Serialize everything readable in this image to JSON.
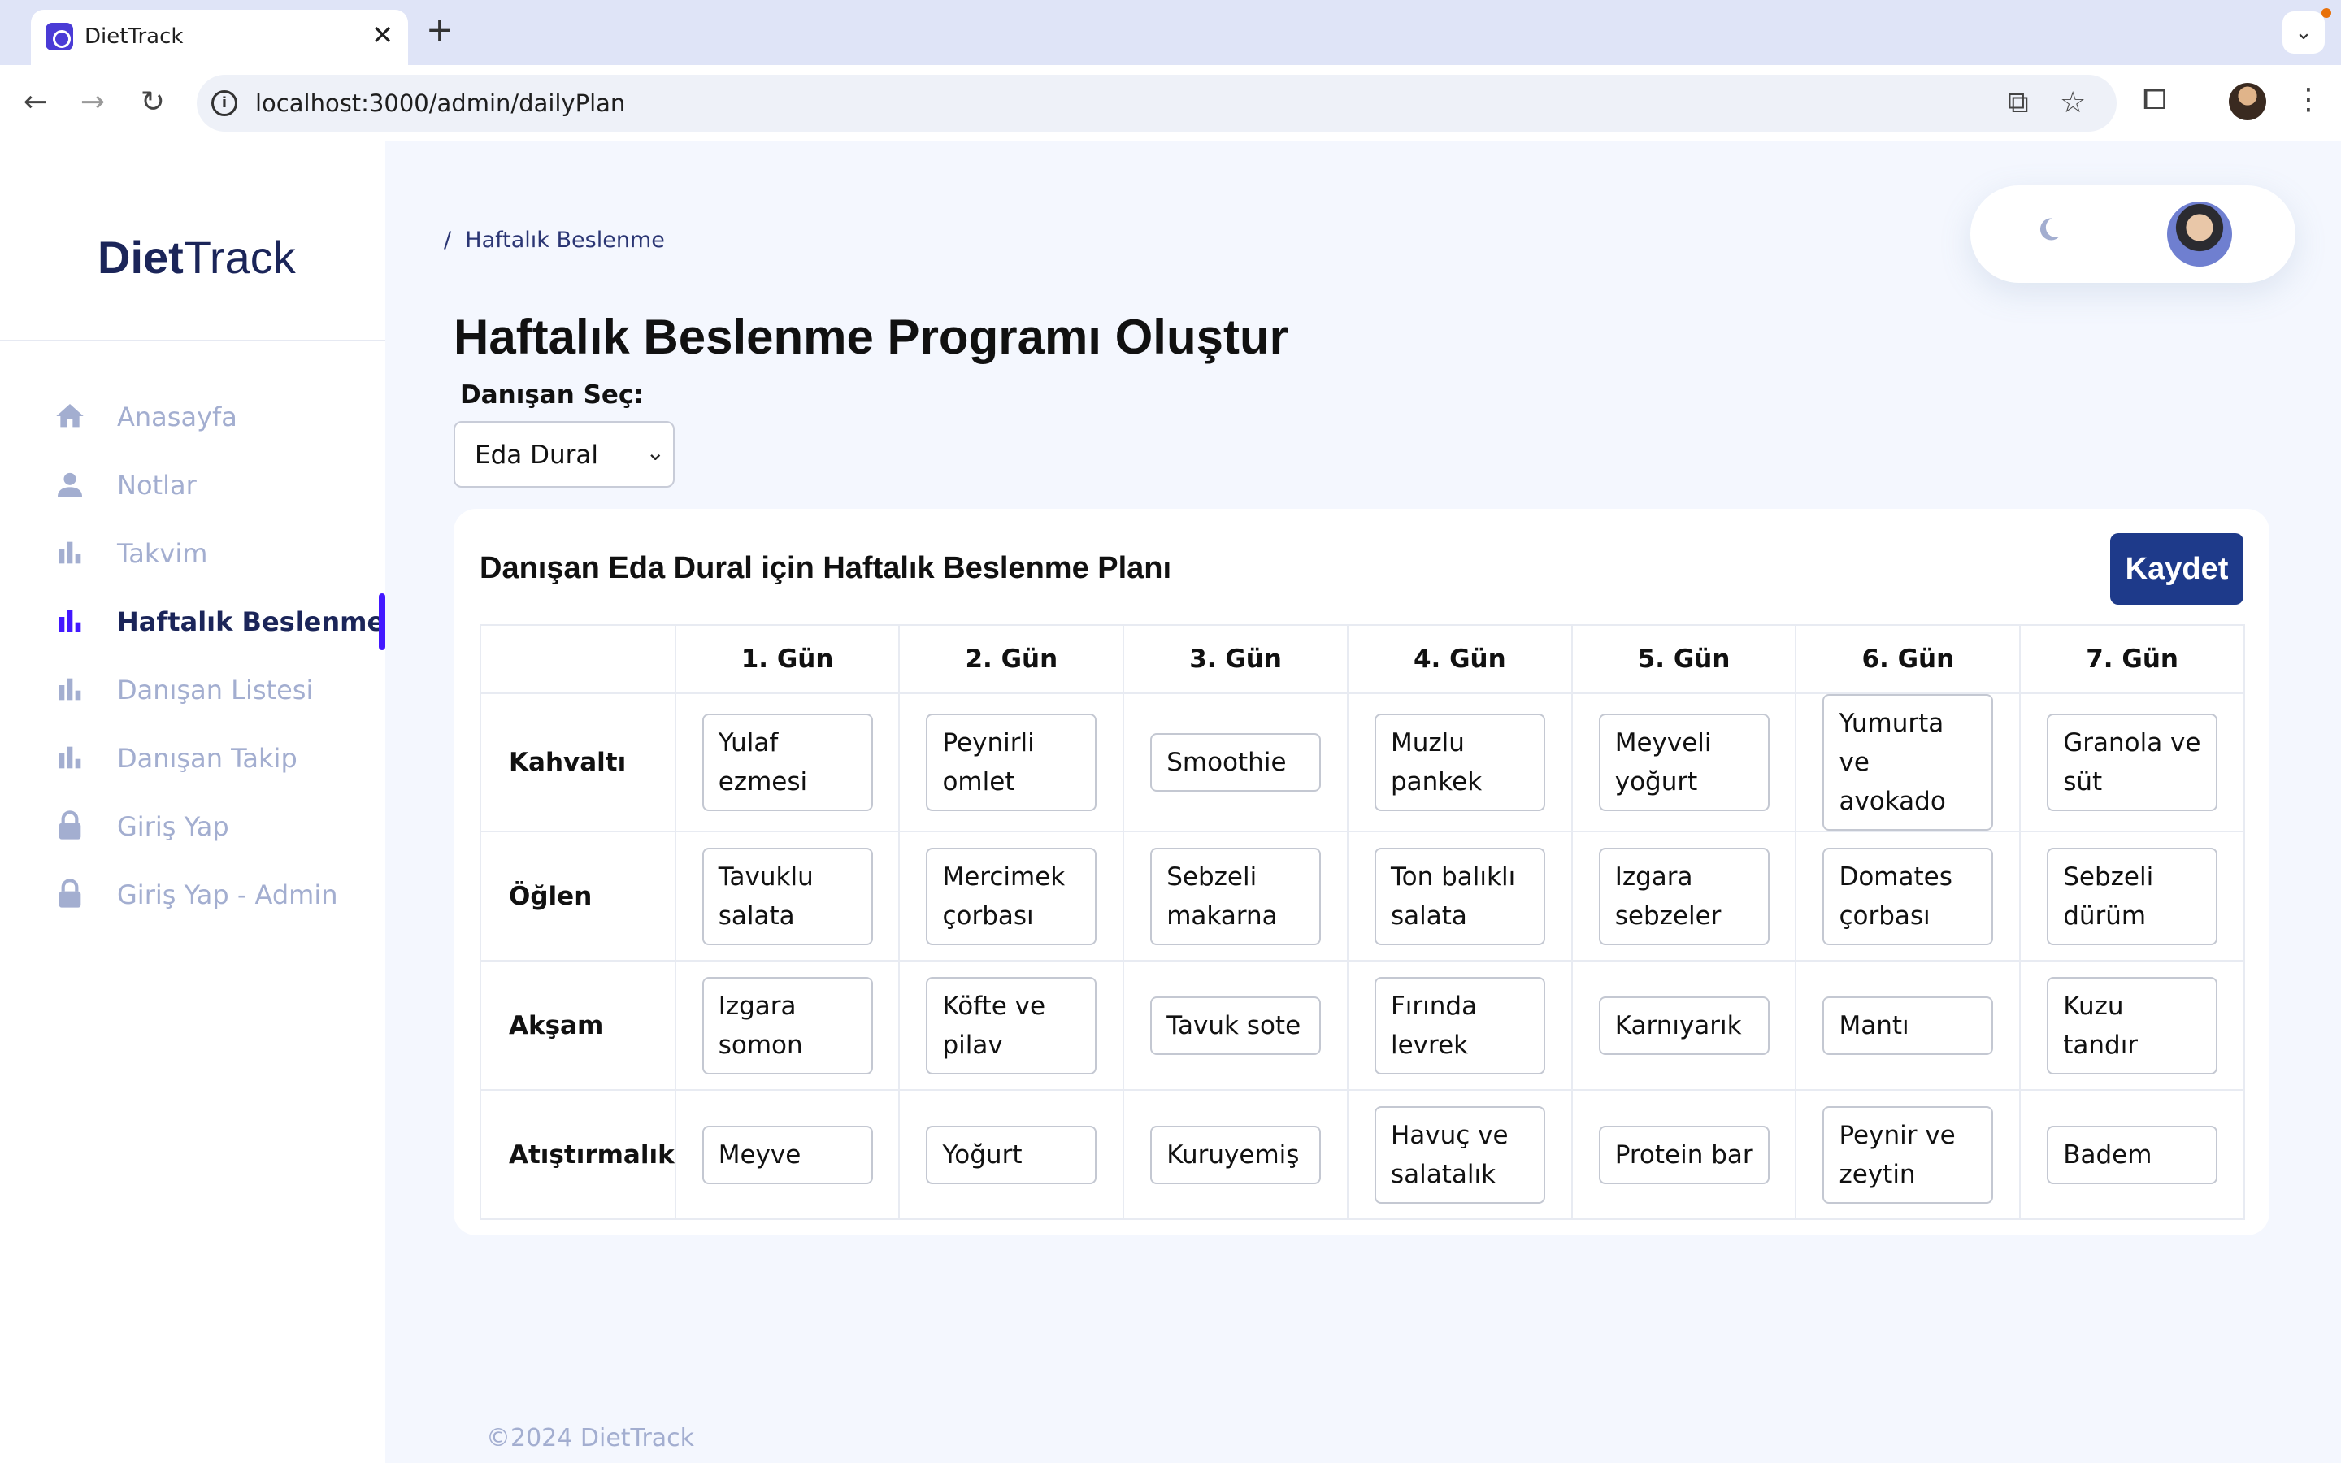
{
  "browser": {
    "tab_title": "DietTrack",
    "tab_close": "✕",
    "new_tab": "+",
    "url": "localhost:3000/admin/dailyPlan"
  },
  "sidebar": {
    "logo_bold": "Diet",
    "logo_light": "Track",
    "items": [
      {
        "label": "Anasayfa",
        "icon": "home-icon"
      },
      {
        "label": "Notlar",
        "icon": "person-icon"
      },
      {
        "label": "Takvim",
        "icon": "bar-chart-icon"
      },
      {
        "label": "Haftalık Beslenme",
        "icon": "bar-chart-icon",
        "active": true
      },
      {
        "label": "Danışan Listesi",
        "icon": "bar-chart-icon"
      },
      {
        "label": "Danışan Takip",
        "icon": "bar-chart-icon"
      },
      {
        "label": "Giriş Yap",
        "icon": "lock-icon"
      },
      {
        "label": "Giriş Yap - Admin",
        "icon": "lock-icon"
      }
    ]
  },
  "header": {
    "breadcrumb_sep": "/",
    "breadcrumb": "Haftalık Beslenme",
    "title": "Haftalık Beslenme Programı Oluştur"
  },
  "client": {
    "label": "Danışan Seç:",
    "selected": "Eda Dural"
  },
  "plan": {
    "title": "Danışan Eda Dural için Haftalık Beslenme Planı",
    "save_label": "Kaydet",
    "days": [
      "1. Gün",
      "2. Gün",
      "3. Gün",
      "4. Gün",
      "5. Gün",
      "6. Gün",
      "7. Gün"
    ],
    "meals": [
      {
        "name": "Kahvaltı",
        "items": [
          "Yulaf ezmesi",
          "Peynirli omlet",
          "Smoothie",
          "Muzlu pankek",
          "Meyveli yoğurt",
          "Yumurta ve avokado",
          "Granola ve süt"
        ]
      },
      {
        "name": "Öğlen",
        "items": [
          "Tavuklu salata",
          "Mercimek çorbası",
          "Sebzeli makarna",
          "Ton balıklı salata",
          "Izgara sebzeler",
          "Domates çorbası",
          "Sebzeli dürüm"
        ]
      },
      {
        "name": "Akşam",
        "items": [
          "Izgara somon",
          "Köfte ve pilav",
          "Tavuk sote",
          "Fırında levrek",
          "Karnıyarık",
          "Mantı",
          "Kuzu tandır"
        ]
      },
      {
        "name": "Atıştırmalık",
        "items": [
          "Meyve",
          "Yoğurt",
          "Kuruyemiş",
          "Havuç ve salatalık",
          "Protein bar",
          "Peynir ve zeytin",
          "Badem"
        ]
      }
    ]
  },
  "footer": "©2024 DietTrack",
  "colors": {
    "accent": "#4318ff",
    "primary_text": "#1b2559",
    "muted_text": "#a3aed0",
    "save_button": "#1e3a8a"
  }
}
